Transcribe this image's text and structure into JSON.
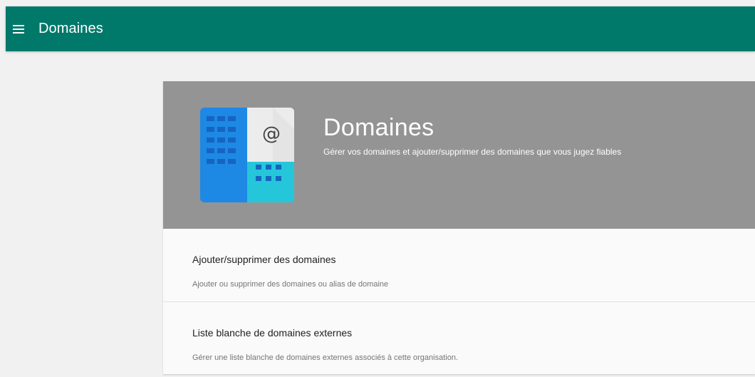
{
  "header": {
    "menu_icon": "menu-icon",
    "title": "Domaines",
    "background_color": "#00796b"
  },
  "hero": {
    "icon": "domains-building-at-icon",
    "at_symbol": "@",
    "title": "Domaines",
    "subtitle": "Gérer vos domaines et ajouter/supprimer des domaines que vous jugez fiables",
    "background_color": "#949494"
  },
  "sections": [
    {
      "title": "Ajouter/supprimer des domaines",
      "description": "Ajouter ou supprimer des domaines ou alias de domaine"
    },
    {
      "title": "Liste blanche de domaines externes",
      "description": "Gérer une liste blanche de domaines externes associés à cette organisation."
    }
  ]
}
